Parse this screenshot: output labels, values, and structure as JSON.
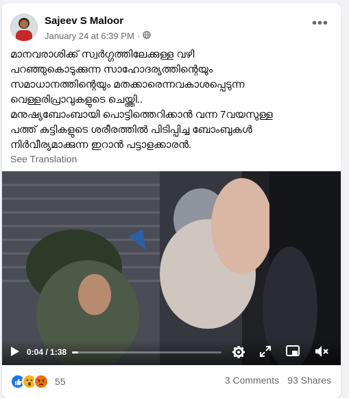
{
  "post": {
    "author": "Sajeev S Maloor",
    "timestamp": "January 24 at 6:39 PM",
    "separator": "·",
    "audience_icon": "globe-icon",
    "more_icon": "more-options-icon",
    "text_lines": [
      "മാനവരാശിക്ക് സ്വർഗ്ഗത്തിലേക്കുള്ള വഴി",
      "പറഞ്ഞുകൊടുക്കുന്ന സാഹോദര്യത്തിന്റെയും",
      "സമാധാനത്തിന്റെയും മതക്കാരെന്നവകാശപ്പെടുന്ന",
      "വെള്ളരിപ്രാവുകളുടെ ചെയ്ത്തി..",
      "മനുഷ്യബോംബായി പൊട്ടിത്തെറിക്കാൻ വന്ന 7വയസുള്ള",
      "പത്ത് കുട്ടികളുടെ ശരീരത്തിൽ പിടിപ്പിച്ച ബോംബുകൾ",
      "നിർവീര്യമാക്കുന്ന ഇറാൻ പട്ടാളക്കാരൻ."
    ],
    "see_translation": "See Translation"
  },
  "video": {
    "current_time": "0:04",
    "duration": "1:38",
    "time_separator": " / ",
    "progress_fraction": 0.04,
    "icons": [
      "play-icon",
      "settings-icon",
      "fullscreen-icon",
      "picture-in-picture-icon",
      "volume-muted-icon"
    ]
  },
  "footer": {
    "reaction_icons": [
      "like-icon",
      "wow-icon",
      "angry-icon"
    ],
    "reaction_count": "55",
    "comments": "3 Comments",
    "shares": "93 Shares"
  },
  "colors": {
    "like_blue": "#1877f2",
    "emoji_yellow": "#f7b125",
    "angry_orange": "#e9710f"
  }
}
